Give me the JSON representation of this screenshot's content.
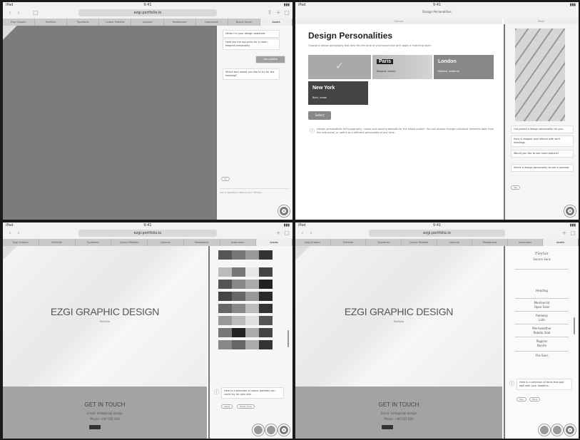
{
  "browser": {
    "status_time": "9:41",
    "url": "ezgi.portfolio.io",
    "tabs": [
      "Ezgi Graphic",
      "Portfolio",
      "Typefaces",
      "Colour Palettes",
      "Layouts",
      "Moodboard",
      "Inspiration",
      "Brand Guide",
      "Logos",
      "Assets"
    ]
  },
  "q1": {
    "bubble1": "Hello! I'm your design assistant.",
    "bubble2": "Here are the top picks for a clean, elegant personality.",
    "bubble3": "Use palette",
    "bubble4": "Which font would you like to try for the heading?",
    "chip": "Try",
    "input_placeholder": "Ask a question about your design..."
  },
  "q2": {
    "window_title": "Design Personalities",
    "left_subtitle": "Canvas",
    "right_subtitle": "Panel",
    "title": "Design Personalities",
    "subtitle": "Choose a design personality that best fits the tone of your brand and we'll apply a matching style.",
    "cards": [
      {
        "name": "",
        "desc": ""
      },
      {
        "name": "Paris",
        "desc": "Elegant, classic"
      },
      {
        "name": "London",
        "desc": "Modern, editorial"
      },
      {
        "name": "New York",
        "desc": "Bold, urban"
      }
    ],
    "button": "Select",
    "help": "Design personalities set typography, colour and spacing defaults for the whole project. You can always change individual elements later from the side panel, or switch to a different personality at any time.",
    "side_msgs": [
      "I've picked a design personality for you.",
      "Paris is elegant and refined with serif headings.",
      "Would you like to see more options?",
      "Select a design personality to see a preview."
    ],
    "side_chip": "Yes"
  },
  "q3": {
    "hero_title": "EZGI GRAPHIC DESIGN",
    "hero_sub": "Portfolio",
    "contact_title": "GET IN TOUCH",
    "contact_email": "Email: hello@ezgi.design",
    "contact_phone": "Phone: +90 555 000",
    "palette_msg": "Here is a selection of colour palettes you could try for your site.",
    "chip1": "Apply",
    "chip2": "Show more"
  },
  "q4": {
    "hero_title": "EZGI GRAPHIC DESIGN",
    "hero_sub": "Portfolio",
    "contact_title": "GET IN TOUCH",
    "contact_email": "Email: hello@ezgi.design",
    "contact_phone": "Phone: +90 555 000",
    "fonts": [
      "Playfair",
      "Source Sans",
      "Heading",
      "Montserrat",
      "Open Sans",
      "Raleway",
      "Lato",
      "Merriweather",
      "Roboto Slab",
      "Poppins",
      "Nunito",
      "Fira Sans"
    ],
    "font_msg": "Here is a selection of fonts that pair well with your headline.",
    "chip1": "Use",
    "chip2": "More"
  },
  "colors": {
    "palette_swatches": [
      [
        "#555",
        "#777",
        "#999",
        "#333"
      ],
      [
        "#bbb",
        "#777",
        "#e6e6e6",
        "#444"
      ],
      [
        "#555",
        "#888",
        "#aaa",
        "#222"
      ],
      [
        "#444",
        "#666",
        "#999",
        "#2a2a2a"
      ],
      [
        "#666",
        "#888",
        "#bbb",
        "#333"
      ],
      [
        "#999",
        "#bbb",
        "#e0e0e0",
        "#555"
      ],
      [
        "#777",
        "#222",
        "#aaa",
        "#444"
      ],
      [
        "#888",
        "#666",
        "#aaa",
        "#333"
      ]
    ]
  }
}
